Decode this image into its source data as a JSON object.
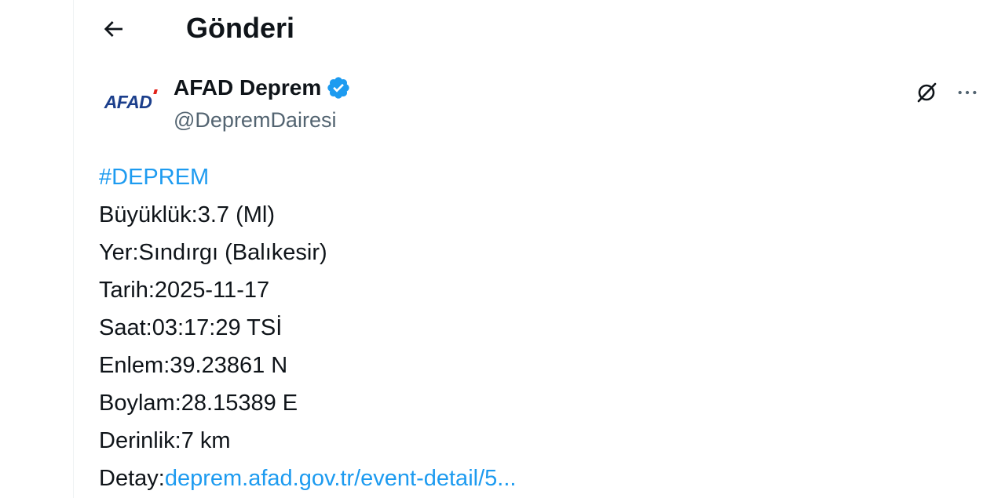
{
  "header": {
    "title": "Gönderi",
    "back_icon": "arrow-left-icon"
  },
  "author": {
    "avatar_text": "AFAD",
    "display_name": "AFAD Deprem",
    "handle": "@DepremDairesi",
    "verified": true,
    "verified_icon": "verified-badge-icon",
    "grok_icon": "grok-icon",
    "more_icon": "more-horizontal-icon"
  },
  "post": {
    "hashtag": "#DEPREM",
    "lines": [
      "Büyüklük:3.7 (Ml)",
      "Yer:Sındırgı (Balıkesir)",
      "Tarih:2025-11-17",
      "Saat:03:17:29 TSİ",
      "Enlem:39.23861 N",
      "Boylam:28.15389 E",
      "Derinlik:7 km"
    ],
    "detail_label": "Detay:",
    "detail_link": "deprem.afad.gov.tr/event-detail/5..."
  },
  "colors": {
    "accent": "#1d9bf0",
    "text": "#0f1419",
    "muted": "#536471",
    "brand_blue": "#1c3f8c",
    "brand_red": "#e2231a"
  }
}
